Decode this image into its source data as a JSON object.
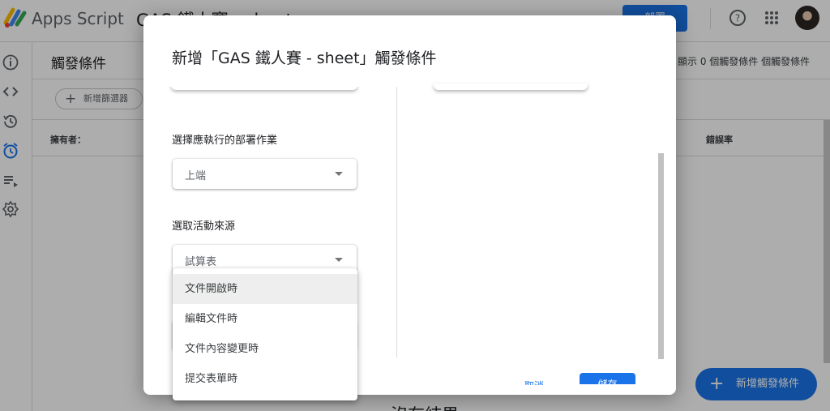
{
  "app": {
    "name": "Apps Script",
    "project_name": "GAS 鐵人賽 - sheet",
    "deploy_label": "部署",
    "logo_icon": "apps-script-logo",
    "help_icon": "help-circle-icon",
    "apps_icon": "apps-grid-icon"
  },
  "sidebar": {
    "items": [
      {
        "icon": "info-icon"
      },
      {
        "icon": "code-icon"
      },
      {
        "icon": "history-icon"
      },
      {
        "icon": "alarm-icon",
        "active": true
      },
      {
        "icon": "playlist-play-icon"
      },
      {
        "icon": "settings-icon"
      }
    ]
  },
  "page": {
    "title": "觸發條件",
    "showing_text": "顯示 0 個觸發條件 個觸發條件",
    "add_filter_label": "新增篩選器",
    "columns": {
      "owner": "擁有者：",
      "error_rate": "錯誤率"
    },
    "empty_text": "沒有結果",
    "fab_label": "新增觸發條件"
  },
  "dialog": {
    "title": "新增「GAS 鐵人賽 - sheet」觸發條件",
    "deployment_label": "選擇應執行的部署作業",
    "deployment_value": "上端",
    "event_source_label": "選取活動來源",
    "event_source_value": "試算表",
    "cancel_label": "取消",
    "save_label": "儲存"
  },
  "event_type_menu": {
    "options": [
      "文件開啟時",
      "編輯文件時",
      "文件內容變更時",
      "提交表單時"
    ],
    "highlighted_index": 0
  },
  "colors": {
    "accent": "#1a73e8",
    "active_icon": "#1a73e8",
    "scrim": "rgba(0,0,0,0.32)"
  }
}
